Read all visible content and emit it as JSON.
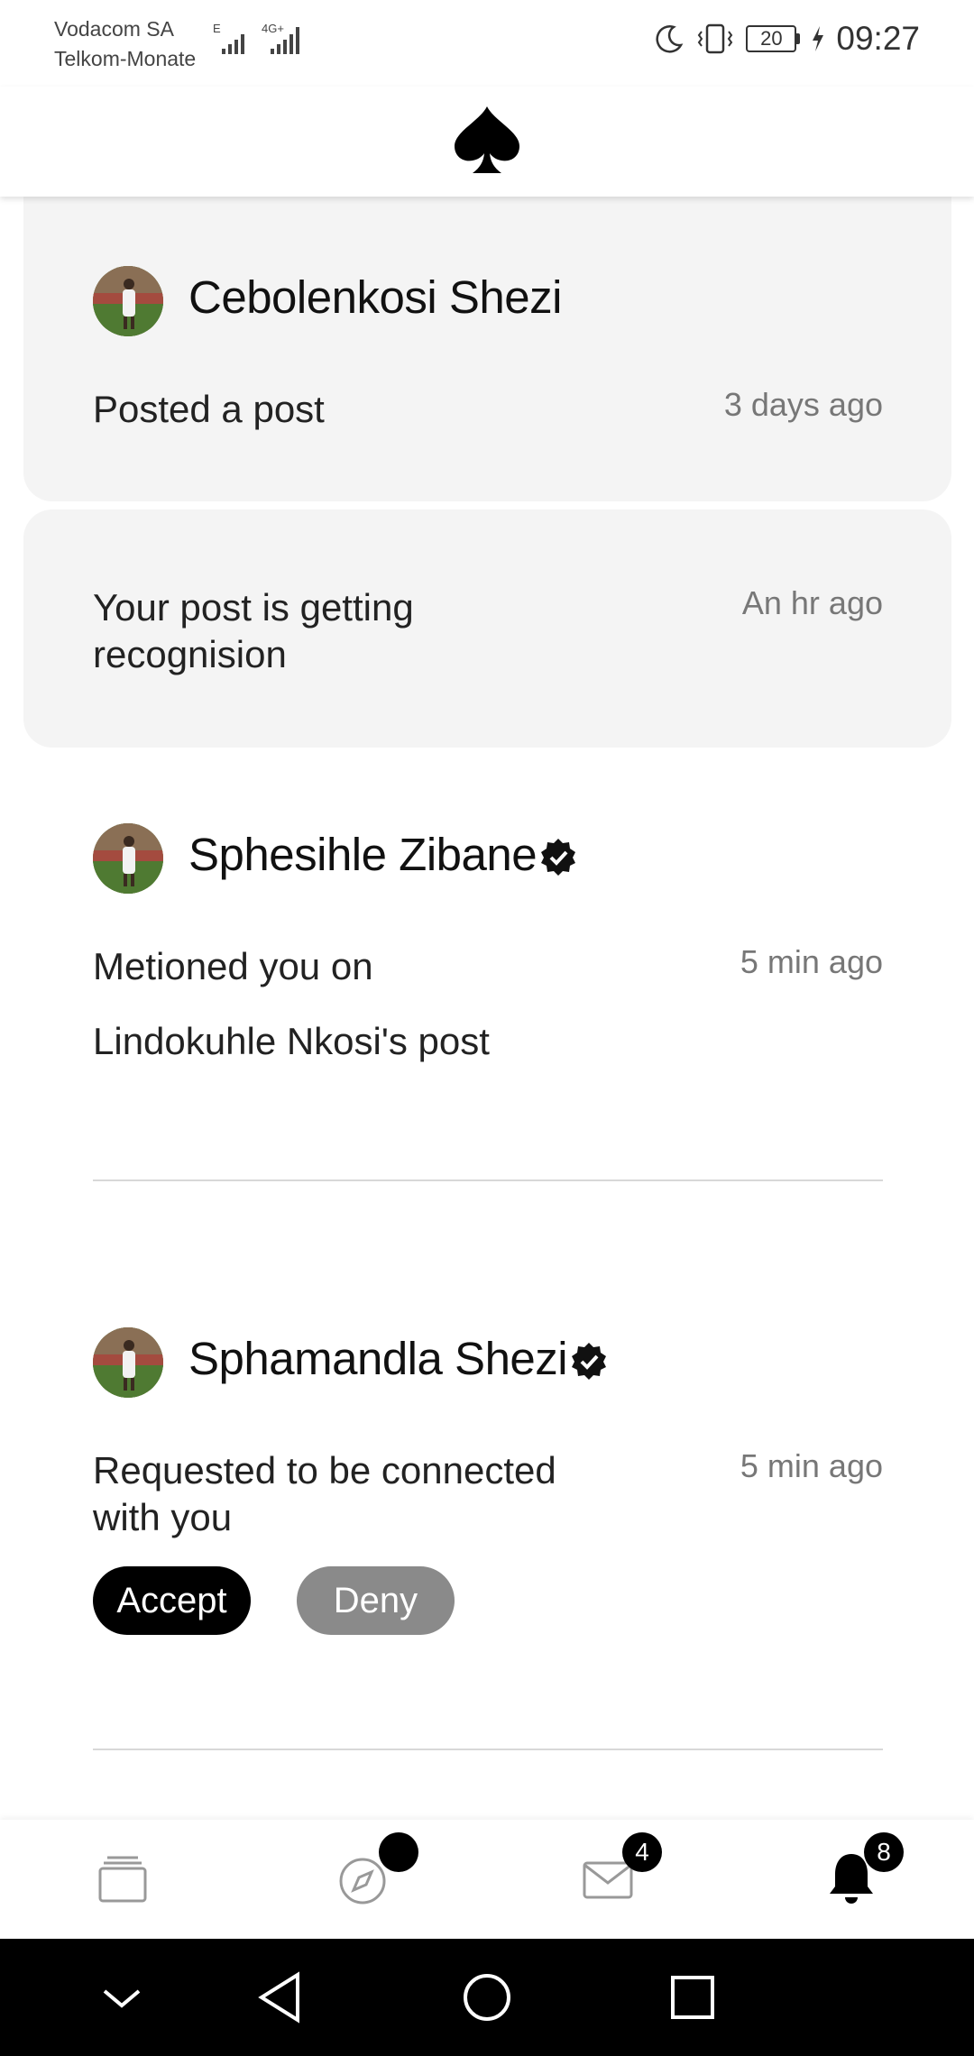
{
  "status_bar": {
    "carrier_1": "Vodacom SA",
    "carrier_2": "Telkom-Monate",
    "network_1": "E",
    "network_2": "4G+",
    "battery": "20",
    "time": "09:27"
  },
  "header": {
    "logo_icon": "spade-icon"
  },
  "notifications": [
    {
      "name": "Cebolenkosi Shezi",
      "verified": false,
      "text": "Posted a post",
      "time": "3 days ago"
    },
    {
      "text": "Your post is getting recognision",
      "time": "An hr ago"
    },
    {
      "name": "Sphesihle Zibane",
      "verified": true,
      "text_line1": "Metioned you on",
      "text_line2": "Lindokuhle Nkosi's post",
      "time": "5 min ago"
    },
    {
      "name": "Sphamandla Shezi",
      "verified": true,
      "text": "Requested to be connected with you",
      "time": "5 min ago",
      "accept_label": "Accept",
      "deny_label": "Deny"
    }
  ],
  "bottom_nav": {
    "items": [
      {
        "icon": "cards-icon"
      },
      {
        "icon": "compass-icon",
        "badge": ""
      },
      {
        "icon": "mail-icon",
        "badge": "4"
      },
      {
        "icon": "bell-icon",
        "badge": "8"
      }
    ]
  },
  "colors": {
    "accent": "#000000",
    "card_bg": "#f4f4f4",
    "deny_bg": "#8a8a8a",
    "muted_text": "#777777"
  }
}
